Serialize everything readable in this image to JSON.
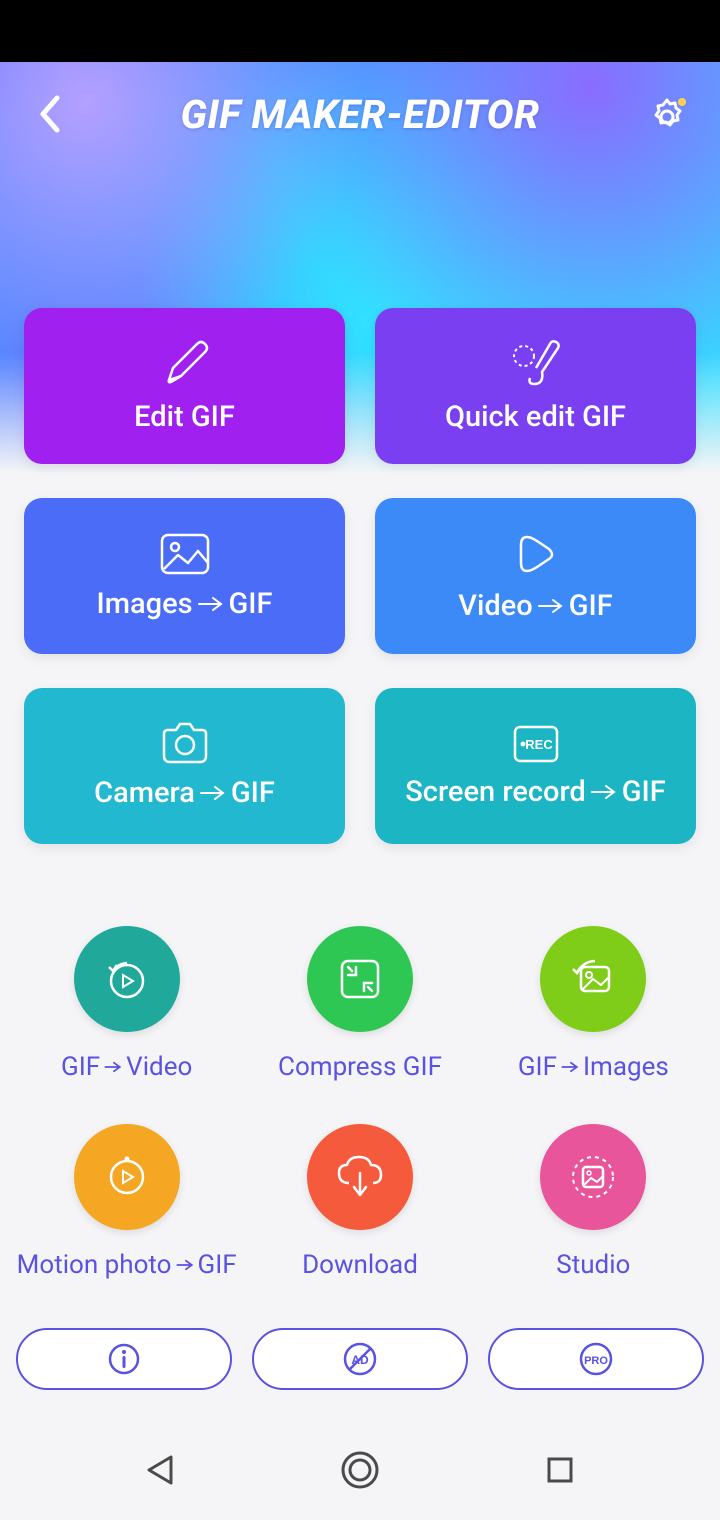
{
  "header": {
    "title": "GIF MAKER-EDITOR"
  },
  "cards": [
    {
      "label": "Edit GIF",
      "bg": "#a020f0",
      "icon": "pencil"
    },
    {
      "label": "Quick edit GIF",
      "bg": "#7b3ff2",
      "icon": "brush-quick"
    },
    {
      "label_a": "Images",
      "label_b": "GIF",
      "bg": "#4a6cf7",
      "icon": "image"
    },
    {
      "label_a": "Video",
      "label_b": "GIF",
      "bg": "#3b8af7",
      "icon": "play"
    },
    {
      "label_a": "Camera",
      "label_b": "GIF",
      "bg": "#22b8cf",
      "icon": "camera"
    },
    {
      "label_a": "Screen record",
      "label_b": "GIF",
      "bg": "#1cb5c3",
      "icon": "rec"
    }
  ],
  "round": [
    {
      "label_a": "GIF",
      "label_b": "Video",
      "bg": "#20a99a",
      "icon": "replay"
    },
    {
      "label": "Compress GIF",
      "bg": "#2ec754",
      "icon": "compress"
    },
    {
      "label_a": "GIF",
      "label_b": "Images",
      "bg": "#7fcc19",
      "icon": "to-images"
    },
    {
      "label_a": "Motion photo",
      "label_b": "GIF",
      "bg": "#f5a623",
      "icon": "motion"
    },
    {
      "label": "Download",
      "bg": "#f55a3c",
      "icon": "download"
    },
    {
      "label": "Studio",
      "bg": "#e8559a",
      "icon": "studio"
    }
  ],
  "pills": {
    "pro_label": "PRO"
  }
}
